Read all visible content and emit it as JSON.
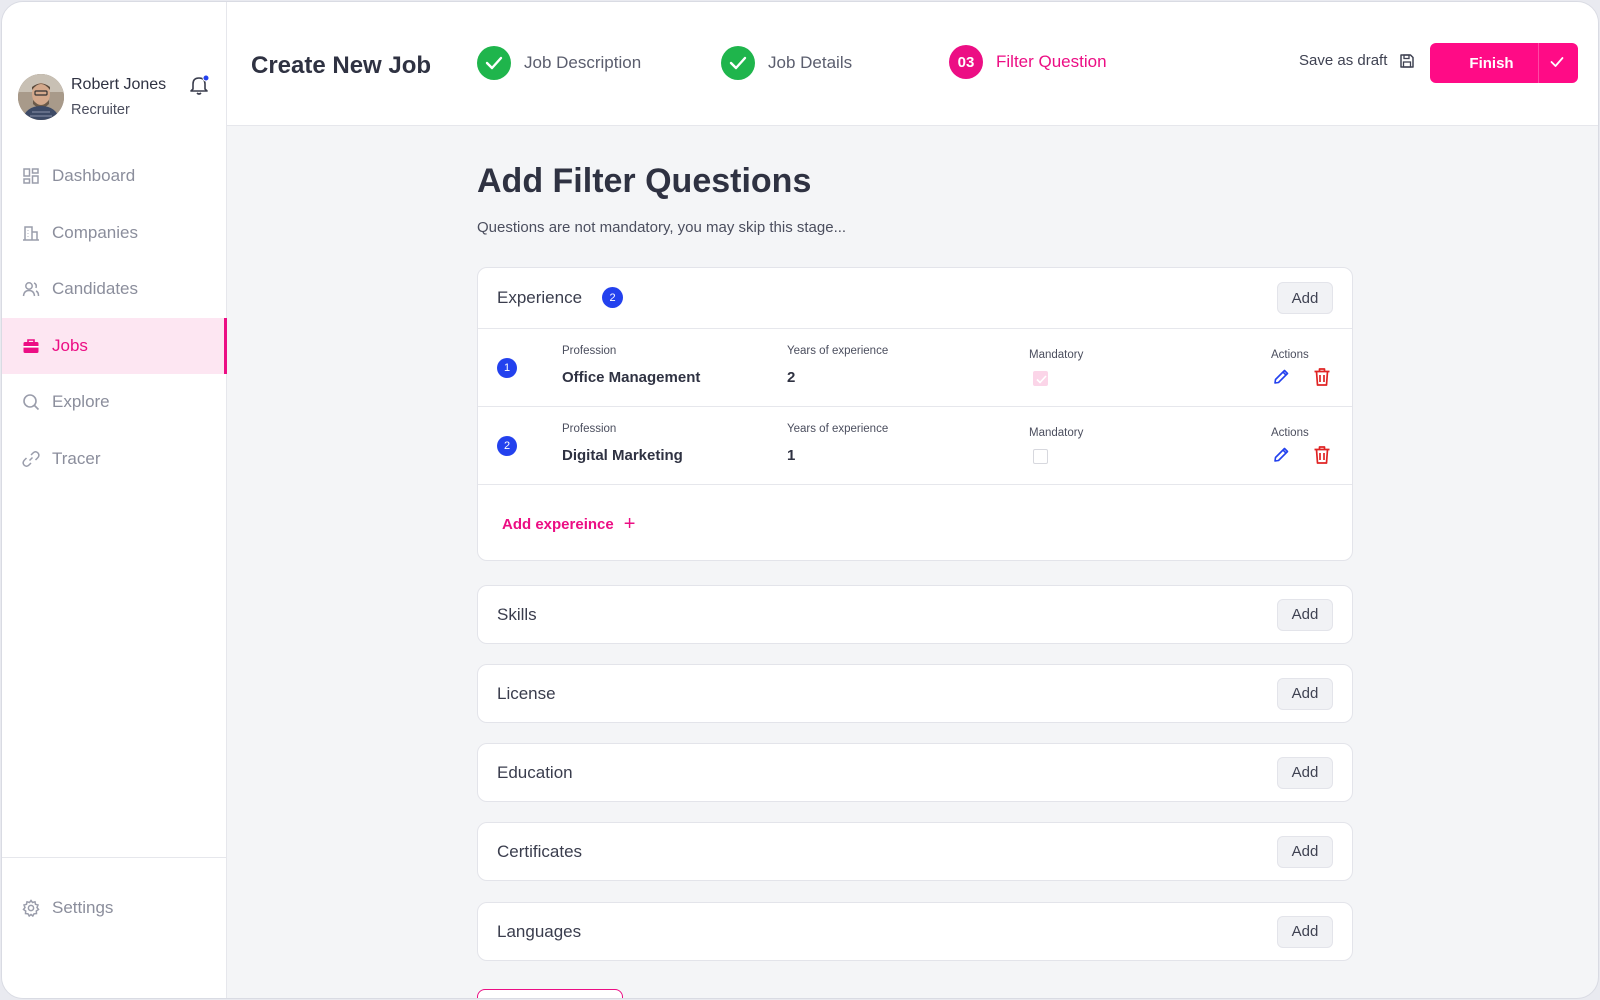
{
  "user": {
    "name": "Robert Jones",
    "role": "Recruiter"
  },
  "nav": {
    "items": [
      {
        "label": "Dashboard",
        "icon": "dashboard-icon"
      },
      {
        "label": "Companies",
        "icon": "building-icon"
      },
      {
        "label": "Candidates",
        "icon": "users-icon"
      },
      {
        "label": "Jobs",
        "icon": "briefcase-icon",
        "active": true
      },
      {
        "label": "Explore",
        "icon": "search-icon"
      },
      {
        "label": "Tracer",
        "icon": "link-icon"
      }
    ],
    "settings": "Settings"
  },
  "header": {
    "title": "Create New Job",
    "steps": [
      {
        "label": "Job Description",
        "state": "done"
      },
      {
        "label": "Job Details",
        "state": "done"
      },
      {
        "label": "Filter Question",
        "state": "current",
        "number": "03"
      }
    ],
    "save_draft": "Save as draft",
    "finish": "Finish"
  },
  "main": {
    "title": "Add Filter Questions",
    "subtitle": "Questions are not mandatory, you may skip this stage...",
    "add_label": "Add",
    "experience": {
      "title": "Experience",
      "count": "2",
      "labels": {
        "profession": "Profession",
        "years": "Years of experience",
        "mandatory": "Mandatory",
        "actions": "Actions"
      },
      "rows": [
        {
          "num": "1",
          "profession": "Office Management",
          "years": "2",
          "mandatory": true
        },
        {
          "num": "2",
          "profession": "Digital Marketing",
          "years": "1",
          "mandatory": false
        }
      ],
      "add_more": "Add expereince",
      "add_more_icon": "+"
    },
    "sections": [
      "Skills",
      "License",
      "Education",
      "Certificates",
      "Languages"
    ]
  },
  "colors": {
    "accent": "#ec0e84",
    "success": "#1fb54c",
    "badge_blue": "#2341ee",
    "delete_red": "#e02424"
  }
}
